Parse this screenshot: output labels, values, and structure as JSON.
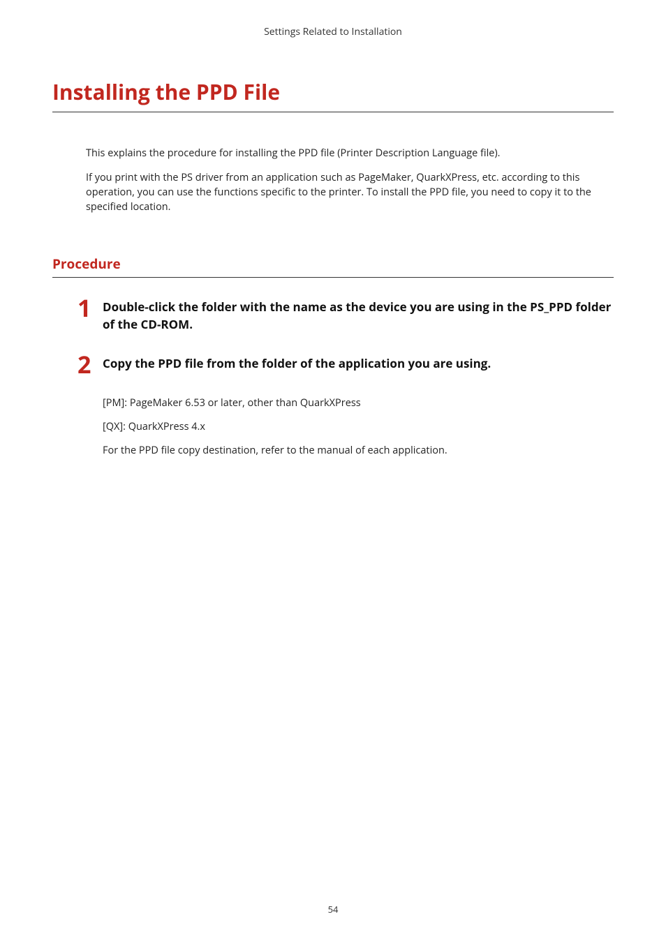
{
  "running_header": "Settings Related to Installation",
  "main_title": "Installing the PPD File",
  "intro": {
    "p1": "This explains the procedure for installing the PPD file (Printer Description Language file).",
    "p2": "If you print with the PS driver from an application such as PageMaker, QuarkXPress, etc. according to this operation, you can use the functions specific to the printer. To install the PPD file, you need to copy it to the specified location."
  },
  "procedure_heading": "Procedure",
  "steps": [
    {
      "num": "1",
      "title": "Double-click the folder with the name as the device you are using in the PS_PPD folder of the CD-ROM."
    },
    {
      "num": "2",
      "title": "Copy the PPD file from the folder of the application you are using."
    }
  ],
  "step2_body": {
    "line1": "[PM]: PageMaker 6.53 or later, other than QuarkXPress",
    "line2": "[QX]: QuarkXPress 4.x",
    "line3": "For the PPD file copy destination, refer to the manual of each application."
  },
  "page_number": "54"
}
